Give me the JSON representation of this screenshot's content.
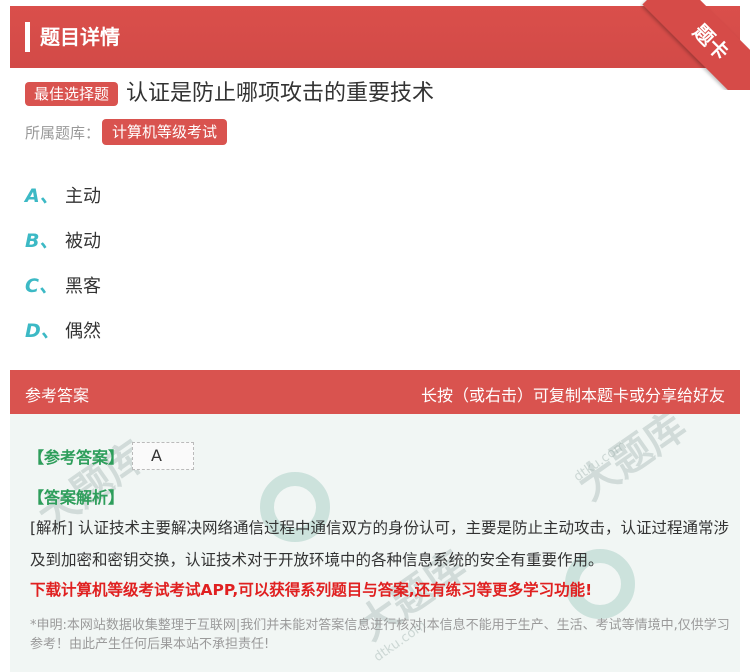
{
  "header": {
    "title": "题目详情",
    "ribbon": "题卡"
  },
  "question": {
    "type_tag": "最佳选择题",
    "text": "认证是防止哪项攻击的重要技术",
    "source_label": "所属题库：",
    "source_tag": "计算机等级考试"
  },
  "options": [
    {
      "letter": "A、",
      "text": "主动"
    },
    {
      "letter": "B、",
      "text": "被动"
    },
    {
      "letter": "C、",
      "text": "黑客"
    },
    {
      "letter": "D、",
      "text": "偶然"
    }
  ],
  "answer_bar": {
    "left": "参考答案",
    "right": "长按（或右击）可复制本题卡或分享给好友"
  },
  "answer": {
    "ref_label": "【参考答案】",
    "ref_value": "A",
    "analysis_label": "【答案解析】",
    "analysis_text": "[解析] 认证技术主要解决网络通信过程中通信双方的身份认可，主要是防止主动攻击，认证过程通常涉及到加密和密钥交换，认证技术对于开放环境中的各种信息系统的安全有重要作用。",
    "promo": "下载计算机等级考试考试APP,可以获得系列题目与答案,还有练习等更多学习功能!",
    "disclaimer": "*申明:本网站数据收集整理于互联网|我们并未能对答案信息进行核对|本信息不能用于生产、生活、考试等情境中,仅供学习参考！由此产生任何后果本站不承担责任!"
  },
  "watermark": {
    "text": "大题库",
    "url": "dtku.com"
  },
  "colors": {
    "accent": "#d9534f",
    "option_letter": "#3cb9c5",
    "green": "#2e9e5b",
    "promo": "#e02020"
  }
}
